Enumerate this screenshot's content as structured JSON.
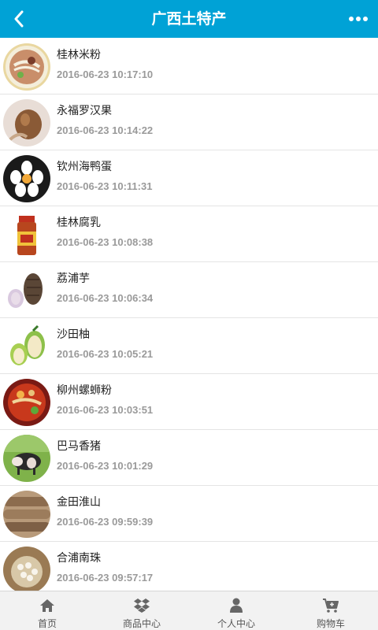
{
  "header": {
    "title": "广西土特产",
    "back_icon": "chevron-left-icon",
    "more_icon": "more-dots-icon",
    "color": "#00a2d6"
  },
  "items": [
    {
      "name": "桂林米粉",
      "time": "2016-06-23 10:17:10",
      "image": "guilin-rice-noodle-image"
    },
    {
      "name": "永福罗汉果",
      "time": "2016-06-23 10:14:22",
      "image": "luohanguo-image"
    },
    {
      "name": "钦州海鸭蛋",
      "time": "2016-06-23 10:11:31",
      "image": "duck-egg-image"
    },
    {
      "name": "桂林腐乳",
      "time": "2016-06-23 10:08:38",
      "image": "fermented-tofu-jar-image"
    },
    {
      "name": "荔浦芋",
      "time": "2016-06-23 10:06:34",
      "image": "taro-image"
    },
    {
      "name": "沙田柚",
      "time": "2016-06-23 10:05:21",
      "image": "pomelo-image"
    },
    {
      "name": "柳州螺蛳粉",
      "time": "2016-06-23 10:03:51",
      "image": "luosifen-image"
    },
    {
      "name": "巴马香猪",
      "time": "2016-06-23 10:01:29",
      "image": "bama-pig-image"
    },
    {
      "name": "金田淮山",
      "time": "2016-06-23 09:59:39",
      "image": "yam-image"
    },
    {
      "name": "合浦南珠",
      "time": "2016-06-23 09:57:17",
      "image": "pearls-image"
    }
  ],
  "tabbar": [
    {
      "label": "首页",
      "icon": "home-icon"
    },
    {
      "label": "商品中心",
      "icon": "dropbox-icon"
    },
    {
      "label": "个人中心",
      "icon": "user-icon"
    },
    {
      "label": "购物车",
      "icon": "cart-icon"
    }
  ]
}
